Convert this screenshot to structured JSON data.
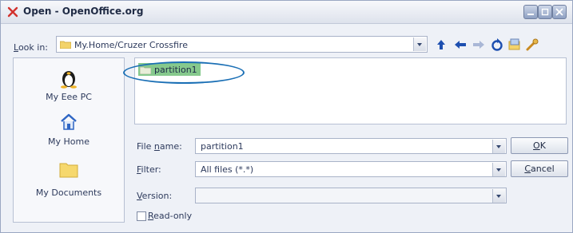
{
  "window": {
    "title": "Open - OpenOffice.org"
  },
  "toolbar": {
    "look_in_label_prefix": "L",
    "look_in_label_rest": "ook in:",
    "look_in_value": "My.Home/Cruzer Crossfire",
    "icons": [
      "up-arrow-icon",
      "back-arrow-icon",
      "forward-arrow-icon",
      "refresh-icon",
      "new-folder-icon",
      "tools-icon"
    ]
  },
  "places": [
    {
      "label": "My Eee PC",
      "icon": "tux-penguin-icon"
    },
    {
      "label": "My Home",
      "icon": "home-icon"
    },
    {
      "label": "My Documents",
      "icon": "folder-icon"
    }
  ],
  "files": [
    {
      "name": "partition1",
      "selected": true
    }
  ],
  "form": {
    "filename_label_a": "File ",
    "filename_label_u": "n",
    "filename_label_b": "ame:",
    "filename_value": "partition1",
    "filter_label_a": "F",
    "filter_label_b": "ilter:",
    "filter_value": "All files (*.*)",
    "version_label_a": "V",
    "version_label_b": "ersion:",
    "version_value": "",
    "readonly_label_a": "R",
    "readonly_label_b": "ead-only"
  },
  "buttons": {
    "ok_u": "O",
    "ok_rest": "K",
    "cancel_u": "C",
    "cancel_rest": "ancel"
  },
  "colors": {
    "selection": "#86c98d",
    "annotation_ring": "#1a6fb5"
  }
}
